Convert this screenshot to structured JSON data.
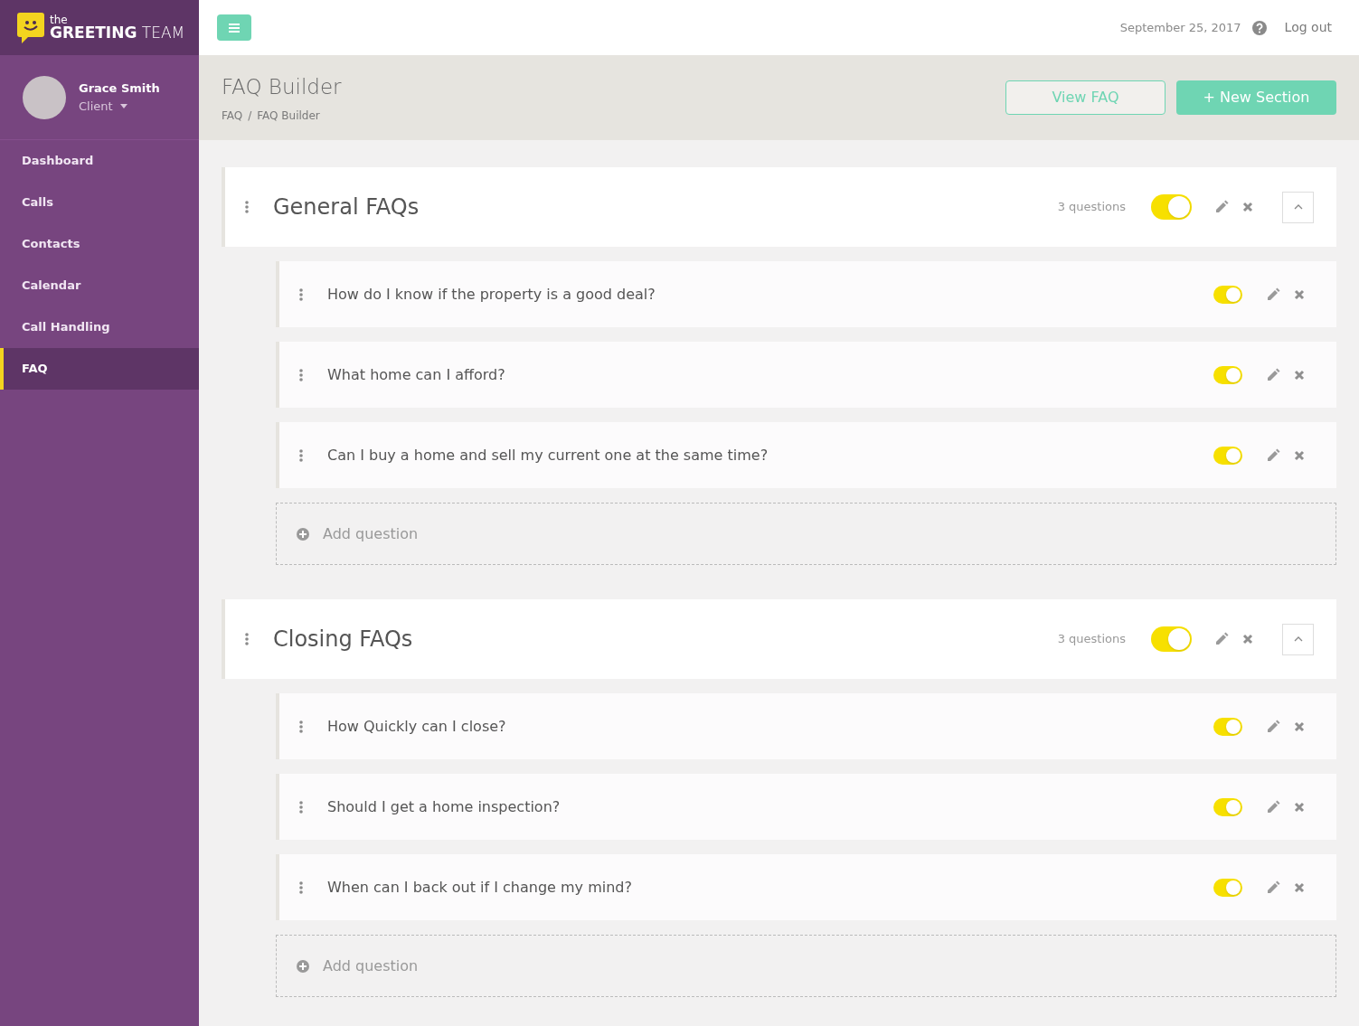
{
  "brand": {
    "small": "the",
    "name_bold": "GREETING",
    "name_light": "TEAM"
  },
  "user": {
    "name": "Grace Smith",
    "role": "Client"
  },
  "sidebar": {
    "items": [
      {
        "label": "Dashboard",
        "selected": false
      },
      {
        "label": "Calls",
        "selected": false
      },
      {
        "label": "Contacts",
        "selected": false
      },
      {
        "label": "Calendar",
        "selected": false
      },
      {
        "label": "Call Handling",
        "selected": false
      },
      {
        "label": "FAQ",
        "selected": true
      }
    ]
  },
  "topbar": {
    "date": "September 25, 2017",
    "logout": "Log out"
  },
  "page": {
    "title": "FAQ Builder",
    "breadcrumb": [
      "FAQ",
      "FAQ Builder"
    ],
    "breadcrumb_separator": "/",
    "view_button": "View FAQ",
    "new_button": "+ New Section"
  },
  "sections": [
    {
      "title": "General FAQs",
      "count": "3 questions",
      "on": true,
      "expanded": true,
      "add_label": "Add question",
      "questions": [
        {
          "text": "How do I know if the property is a good deal?",
          "on": true
        },
        {
          "text": "What home can I afford?",
          "on": true
        },
        {
          "text": "Can I buy a home and sell my current one at the same time?",
          "on": true
        }
      ]
    },
    {
      "title": "Closing FAQs",
      "count": "3 questions",
      "on": true,
      "expanded": true,
      "add_label": "Add question",
      "questions": [
        {
          "text": "How Quickly can I close?",
          "on": true
        },
        {
          "text": "Should I get a home inspection?",
          "on": true
        },
        {
          "text": "When can I back out if I change my mind?",
          "on": true
        }
      ]
    }
  ]
}
